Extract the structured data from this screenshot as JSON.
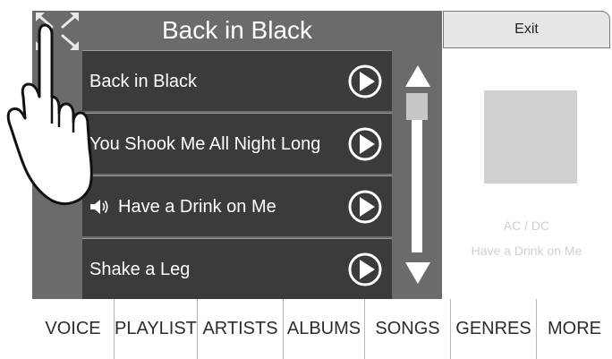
{
  "header": {
    "title": "Back in Black"
  },
  "songs": [
    {
      "title": "Back in Black",
      "playing": false
    },
    {
      "title": "You Shook Me All Night Long",
      "playing": false
    },
    {
      "title": "Have a Drink on Me",
      "playing": true
    },
    {
      "title": "Shake a Leg",
      "playing": false
    }
  ],
  "exit": {
    "label": "Exit"
  },
  "now_playing": {
    "artist": "AC / DC",
    "song": "Have a Drink on Me"
  },
  "tabs": [
    "VOICE",
    "PLAYLISTS",
    "ARTISTS",
    "ALBUMS",
    "SONGS",
    "GENRES",
    "MORE"
  ],
  "icons": {
    "expand": "expand-arrows-icon",
    "play": "play-circle-icon",
    "speaker": "speaker-icon",
    "scroll_up": "triangle-up-icon",
    "scroll_down": "triangle-down-icon",
    "hand": "pointing-hand-icon"
  },
  "colors": {
    "panel": "#6b6b6e",
    "row": "#3b3b3c",
    "text_light": "#ffffff",
    "muted": "#cfcfcf",
    "exit_bg": "#e6e6e6"
  }
}
